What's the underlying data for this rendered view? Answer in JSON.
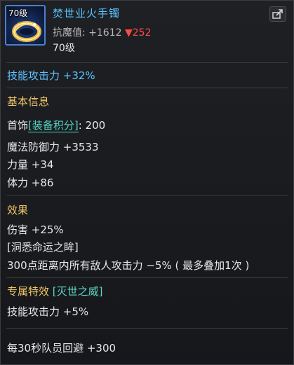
{
  "item": {
    "icon_level": "70级",
    "name": "焚世业火手镯",
    "resist_label": "抗魔值: ",
    "resist_up": "+1612",
    "resist_down": "▼252",
    "level": "70级"
  },
  "skill_attack_top": "技能攻击力 +32%",
  "basic": {
    "title": "基本信息",
    "type_label": "首饰",
    "score_tag": "[装备积分]",
    "score_value": ": 200",
    "stats": [
      "魔法防御力 +3533",
      "力量 +34",
      "体力 +86"
    ]
  },
  "effects": {
    "title": "效果",
    "lines": [
      "伤害 +25%",
      "[洞悉命运之眸]",
      "300点距离内所有敌人攻击力 −5% ( 最多叠加1次 )"
    ]
  },
  "special": {
    "title": "专属特效",
    "tag": "[灭世之威]",
    "lines": [
      "技能攻击力 +5%"
    ]
  },
  "footer": "每30秒队员回避 +300",
  "colors": {
    "name": "#58c4ff",
    "section_title": "#f0c566",
    "tag": "#53d4c8",
    "decrease": "#ff4a4a",
    "icon_border": "#4a7fd1"
  },
  "icons": [
    "bracelet-item-icon",
    "share-icon"
  ]
}
